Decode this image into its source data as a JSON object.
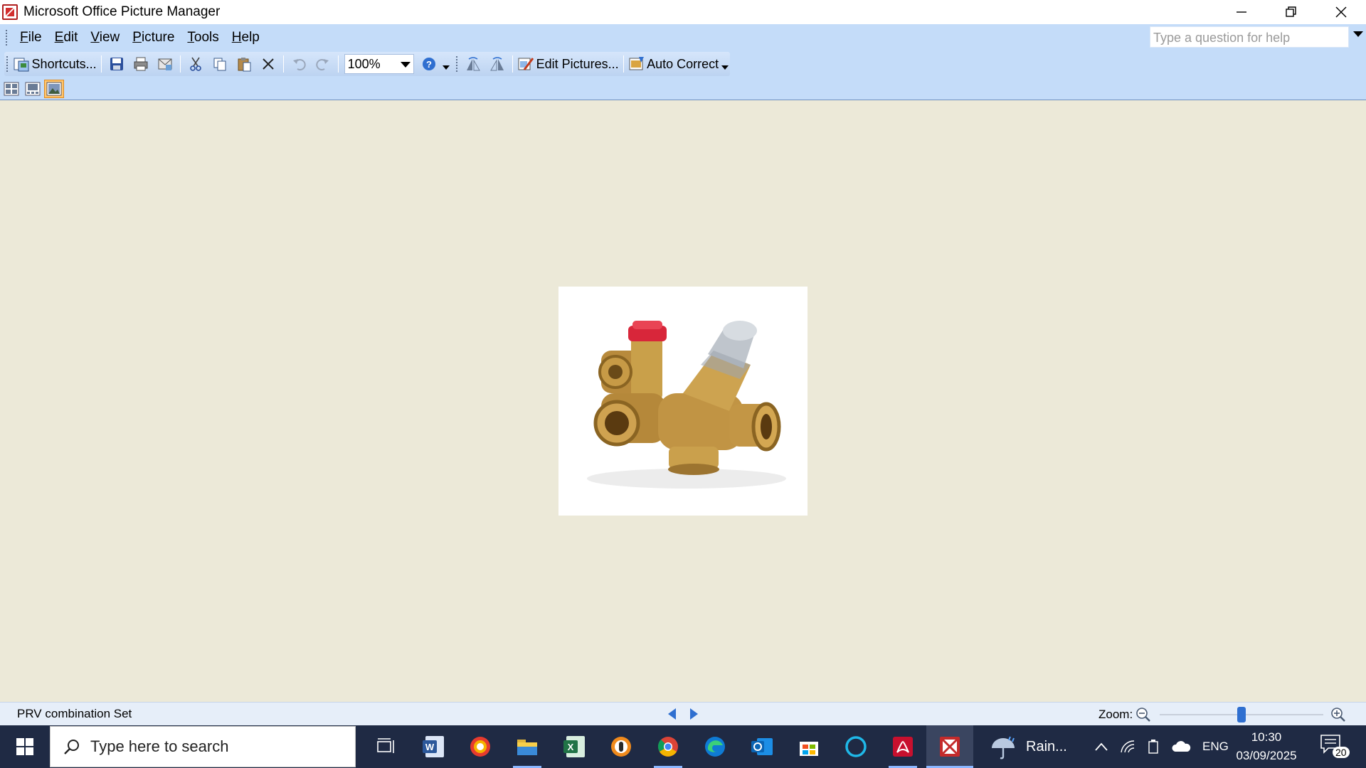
{
  "window": {
    "title": "Microsoft Office Picture Manager"
  },
  "menu": [
    {
      "label": "File",
      "accel": "F",
      "rest": "ile"
    },
    {
      "label": "Edit",
      "accel": "E",
      "rest": "dit"
    },
    {
      "label": "View",
      "accel": "V",
      "rest": "iew"
    },
    {
      "label": "Picture",
      "accel": "P",
      "rest": "icture"
    },
    {
      "label": "Tools",
      "accel": "T",
      "rest": "ools"
    },
    {
      "label": "Help",
      "accel": "H",
      "rest": "elp"
    }
  ],
  "help": {
    "placeholder": "Type a question for help"
  },
  "toolbar": {
    "shortcuts_label": "Shortcuts...",
    "zoom_value": "100%",
    "edit_pictures_label": "Edit Pictures...",
    "auto_correct_label": "Auto Correct"
  },
  "status": {
    "picture_name": "PRV combination Set",
    "zoom_label": "Zoom:",
    "zoom_level": 0.5
  },
  "taskbar": {
    "search_placeholder": "Type here to search",
    "weather": "Rain...",
    "language": "ENG",
    "time": "10:30",
    "date": "03/09/2025",
    "notification_count": "20"
  },
  "colors": {
    "ribbon": "#c4dcf9",
    "canvas": "#ece9d8",
    "taskbar": "#1f2a44",
    "accent": "#2f6fd0"
  }
}
